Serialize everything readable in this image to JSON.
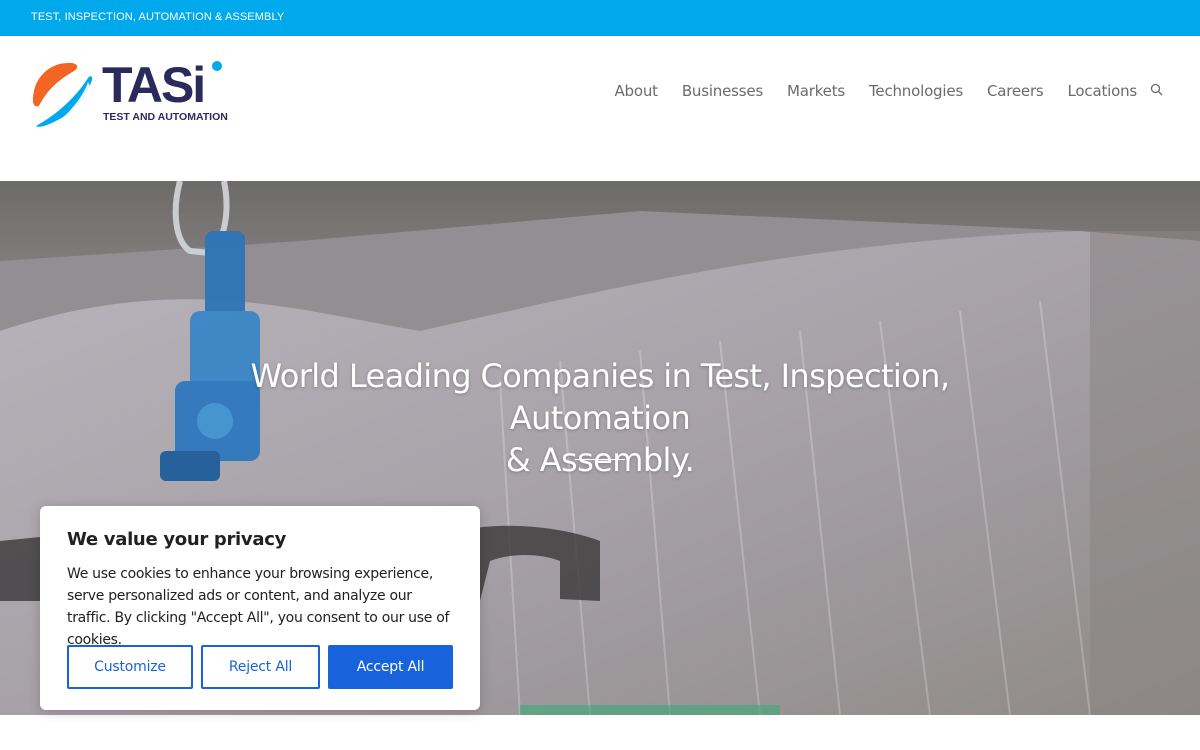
{
  "topbar": {
    "tagline": "TEST, INSPECTION, AUTOMATION & ASSEMBLY"
  },
  "logo": {
    "wordmark": "TASi",
    "subtitle": "TEST AND AUTOMATION"
  },
  "nav": {
    "items": [
      {
        "label": "About"
      },
      {
        "label": "Businesses"
      },
      {
        "label": "Markets"
      },
      {
        "label": "Technologies"
      },
      {
        "label": "Careers"
      },
      {
        "label": "Locations"
      }
    ],
    "search_icon": "search-icon"
  },
  "hero": {
    "title_line1": "World Leading Companies in Test, Inspection, Automation",
    "title_line2": "& Assembly."
  },
  "cookie_banner": {
    "title": "We value your privacy",
    "body": "We use cookies to enhance your browsing experience, serve personalized ads or content, and analyze our traffic. By clicking \"Accept All\", you consent to our use of cookies.",
    "customize_label": "Customize",
    "reject_label": "Reject All",
    "accept_label": "Accept All"
  },
  "colors": {
    "topbar": "#00a8ec",
    "brand_navy": "#2b2a5c",
    "brand_orange": "#f26522",
    "brand_blue": "#00a8ec",
    "nav_text": "#6b6b6b",
    "button_blue": "#1863dc"
  }
}
